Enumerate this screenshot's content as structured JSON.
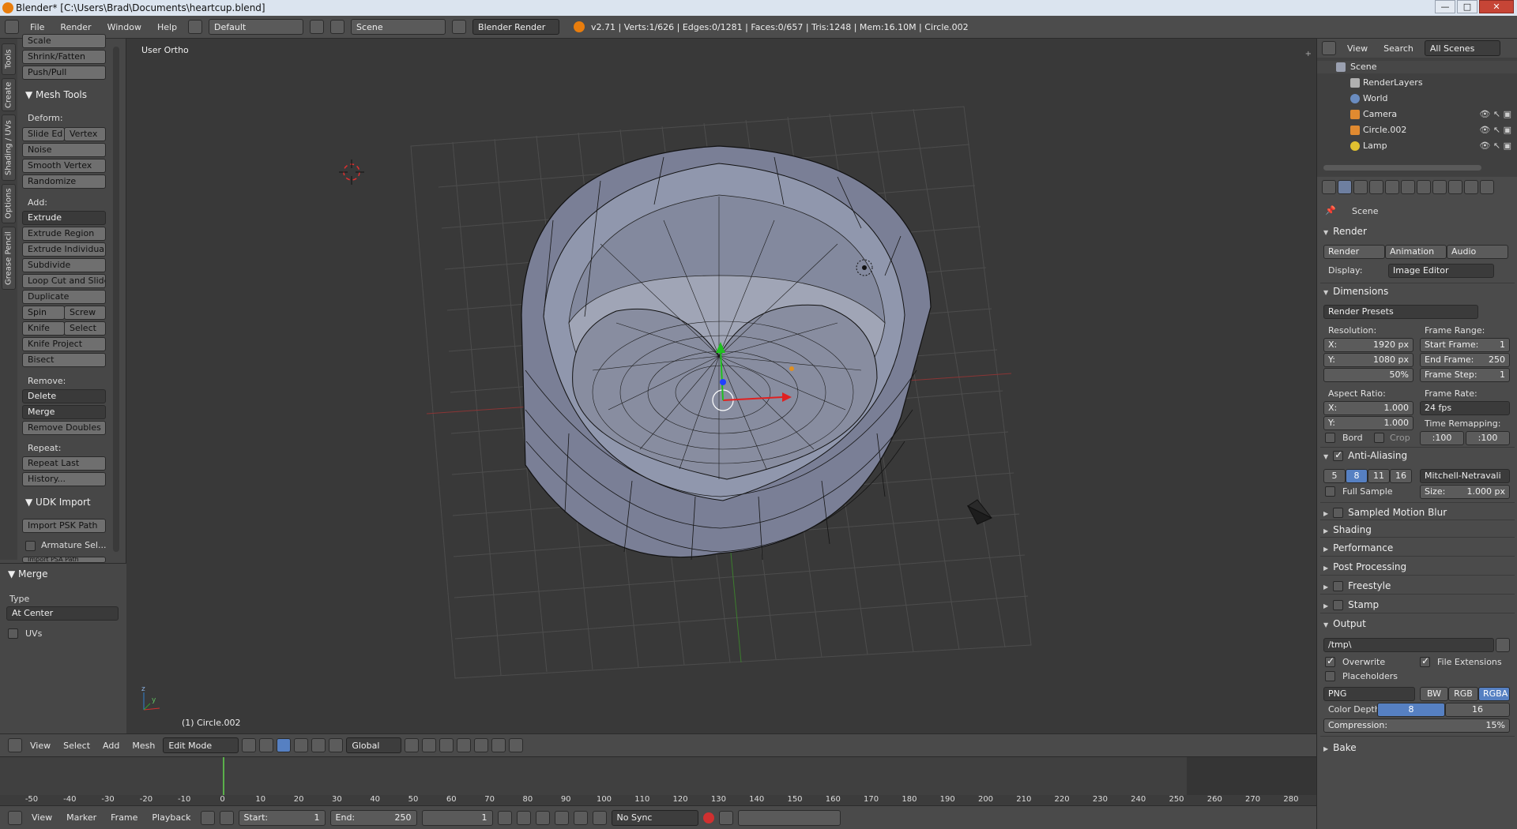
{
  "window": {
    "title": "Blender* [C:\\Users\\Brad\\Documents\\heartcup.blend]",
    "minimize": "—",
    "maximize": "□",
    "close": "✕"
  },
  "infobar": {
    "menus": [
      "File",
      "Render",
      "Window",
      "Help"
    ],
    "layout": "Default",
    "scene": "Scene",
    "engine": "Blender Render",
    "stats": "v2.71 | Verts:1/626 | Edges:0/1281 | Faces:0/657 | Tris:1248 | Mem:16.10M | Circle.002"
  },
  "toolshelf": {
    "tabs": [
      "Tools",
      "Create",
      "Shading / UVs",
      "Options",
      "Grease Pencil"
    ],
    "top_items": [
      "Scale",
      "Shrink/Fatten",
      "Push/Pull"
    ],
    "mesh_tools_title": "Mesh Tools",
    "deform_label": "Deform:",
    "slide_edge": "Slide Ed",
    "vertex": "Vertex",
    "noise": "Noise",
    "smooth_vertex": "Smooth Vertex",
    "randomize": "Randomize",
    "add_label": "Add:",
    "extrude": "Extrude",
    "extrude_region": "Extrude Region",
    "extrude_individual": "Extrude Individual",
    "subdivide": "Subdivide",
    "loop_cut": "Loop Cut and Slide",
    "duplicate": "Duplicate",
    "spin": "Spin",
    "screw": "Screw",
    "knife": "Knife",
    "select": "Select",
    "knife_project": "Knife Project",
    "bisect": "Bisect",
    "remove_label": "Remove:",
    "delete": "Delete",
    "merge": "Merge",
    "remove_doubles": "Remove Doubles",
    "repeat_label": "Repeat:",
    "repeat_last": "Repeat Last",
    "history": "History...",
    "udk_title": "UDK Import",
    "import_psk": "Import PSK Path",
    "armature_sel": "Armature Sel...",
    "import_psa": "Import PSA Path",
    "op_title": "Merge",
    "type_label": "Type",
    "type_value": "At Center",
    "uvs": "UVs"
  },
  "viewport": {
    "view_name": "User Ortho",
    "object_label": "(1) Circle.002",
    "axis_y": "y",
    "axis_z": "z"
  },
  "vheader": {
    "view": "View",
    "select": "Select",
    "add": "Add",
    "mesh": "Mesh",
    "mode": "Edit Mode",
    "orientation": "Global"
  },
  "timeline": {
    "ticks": [
      "-50",
      "-40",
      "-30",
      "-20",
      "-10",
      "0",
      "10",
      "20",
      "30",
      "40",
      "50",
      "60",
      "70",
      "80",
      "90",
      "100",
      "110",
      "120",
      "130",
      "140",
      "150",
      "160",
      "170",
      "180",
      "190",
      "200",
      "210",
      "220",
      "230",
      "240",
      "250",
      "260",
      "270",
      "280"
    ],
    "current_frame": 0
  },
  "tlheader": {
    "view": "View",
    "marker": "Marker",
    "frame": "Frame",
    "playback": "Playback",
    "start": "Start:",
    "start_val": "1",
    "end": "End:",
    "end_val": "250",
    "current": "1",
    "sync": "No Sync"
  },
  "outliner": {
    "view": "View",
    "search": "Search",
    "filter": "All Scenes",
    "rows": [
      "Scene",
      "RenderLayers",
      "World",
      "Camera",
      "Circle.002",
      "Lamp"
    ]
  },
  "props": {
    "scene": "Scene",
    "render_panel": "Render",
    "render_btn": "Render",
    "animation_btn": "Animation",
    "audio_btn": "Audio",
    "display_label": "Display:",
    "display_val": "Image Editor",
    "dimensions": "Dimensions",
    "presets": "Render Presets",
    "resolution": "Resolution:",
    "res_x_label": "X:",
    "res_x": "1920 px",
    "res_y_label": "Y:",
    "res_y": "1080 px",
    "res_pct": "50%",
    "frame_range": "Frame Range:",
    "start_frame_label": "Start Frame:",
    "start_frame": "1",
    "end_frame_label": "End Frame:",
    "end_frame": "250",
    "frame_step_label": "Frame Step:",
    "frame_step": "1",
    "aspect": "Aspect Ratio:",
    "asp_x_label": "X:",
    "asp_x": "1.000",
    "asp_y_label": "Y:",
    "asp_y": "1.000",
    "frame_rate": "Frame Rate:",
    "fps": "24 fps",
    "time_remap": "Time Remapping:",
    "remap_old": ":100",
    "remap_new": ":100",
    "bord": "Bord",
    "crop": "Crop",
    "aa": "Anti-Aliasing",
    "aa_5": "5",
    "aa_8": "8",
    "aa_11": "11",
    "aa_16": "16",
    "aa_filter": "Mitchell-Netravali",
    "full_sample": "Full Sample",
    "size_label": "Size:",
    "size_val": "1.000 px",
    "motion_blur": "Sampled Motion Blur",
    "shading": "Shading",
    "performance": "Performance",
    "post": "Post Processing",
    "freestyle": "Freestyle",
    "stamp": "Stamp",
    "output": "Output",
    "path": "/tmp\\",
    "overwrite": "Overwrite",
    "file_ext": "File Extensions",
    "placeholders": "Placeholders",
    "format": "PNG",
    "bw": "BW",
    "rgb": "RGB",
    "rgba": "RGBA",
    "color_depth": "Color Depth:",
    "depth8": "8",
    "depth16": "16",
    "compression_label": "Compression:",
    "compression_val": "15%",
    "bake": "Bake"
  }
}
